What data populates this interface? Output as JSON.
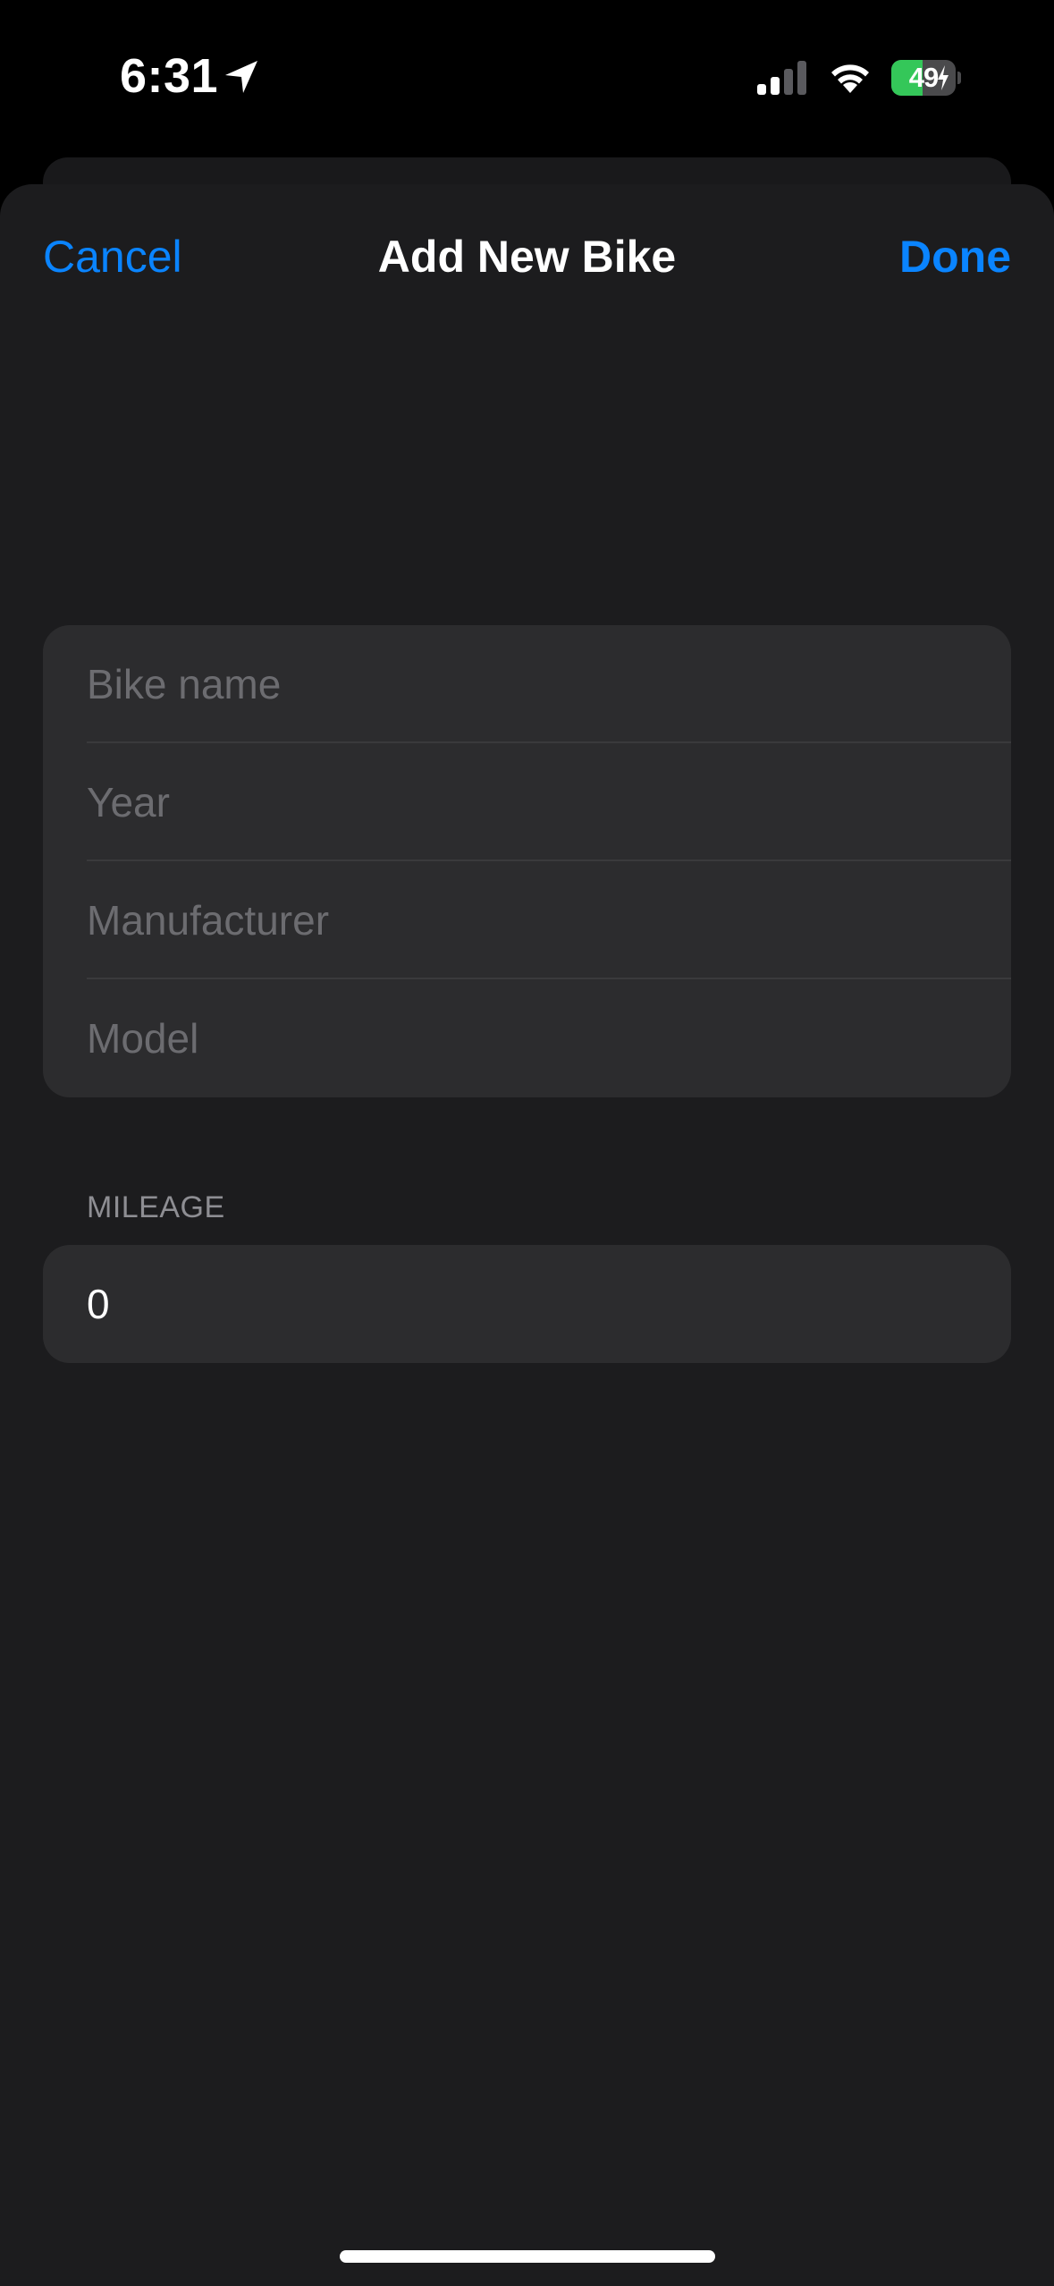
{
  "status_bar": {
    "time": "6:31",
    "battery_percent_text": "49",
    "battery_level": 0.49,
    "location_icon": "location-arrow-icon",
    "signal_icon": "cellular-signal-icon",
    "wifi_icon": "wifi-icon",
    "charging_icon": "charging-bolt-icon"
  },
  "nav": {
    "cancel_label": "Cancel",
    "title": "Add New Bike",
    "done_label": "Done"
  },
  "form": {
    "fields": [
      {
        "placeholder": "Bike name",
        "value": ""
      },
      {
        "placeholder": "Year",
        "value": ""
      },
      {
        "placeholder": "Manufacturer",
        "value": ""
      },
      {
        "placeholder": "Model",
        "value": ""
      }
    ]
  },
  "mileage": {
    "section_header": "MILEAGE",
    "value": "0"
  },
  "colors": {
    "accent": "#0a84ff",
    "sheet_background": "#1c1c1e",
    "group_background": "#2c2c2e",
    "placeholder": "#6c6c70",
    "battery_green": "#34c759"
  }
}
